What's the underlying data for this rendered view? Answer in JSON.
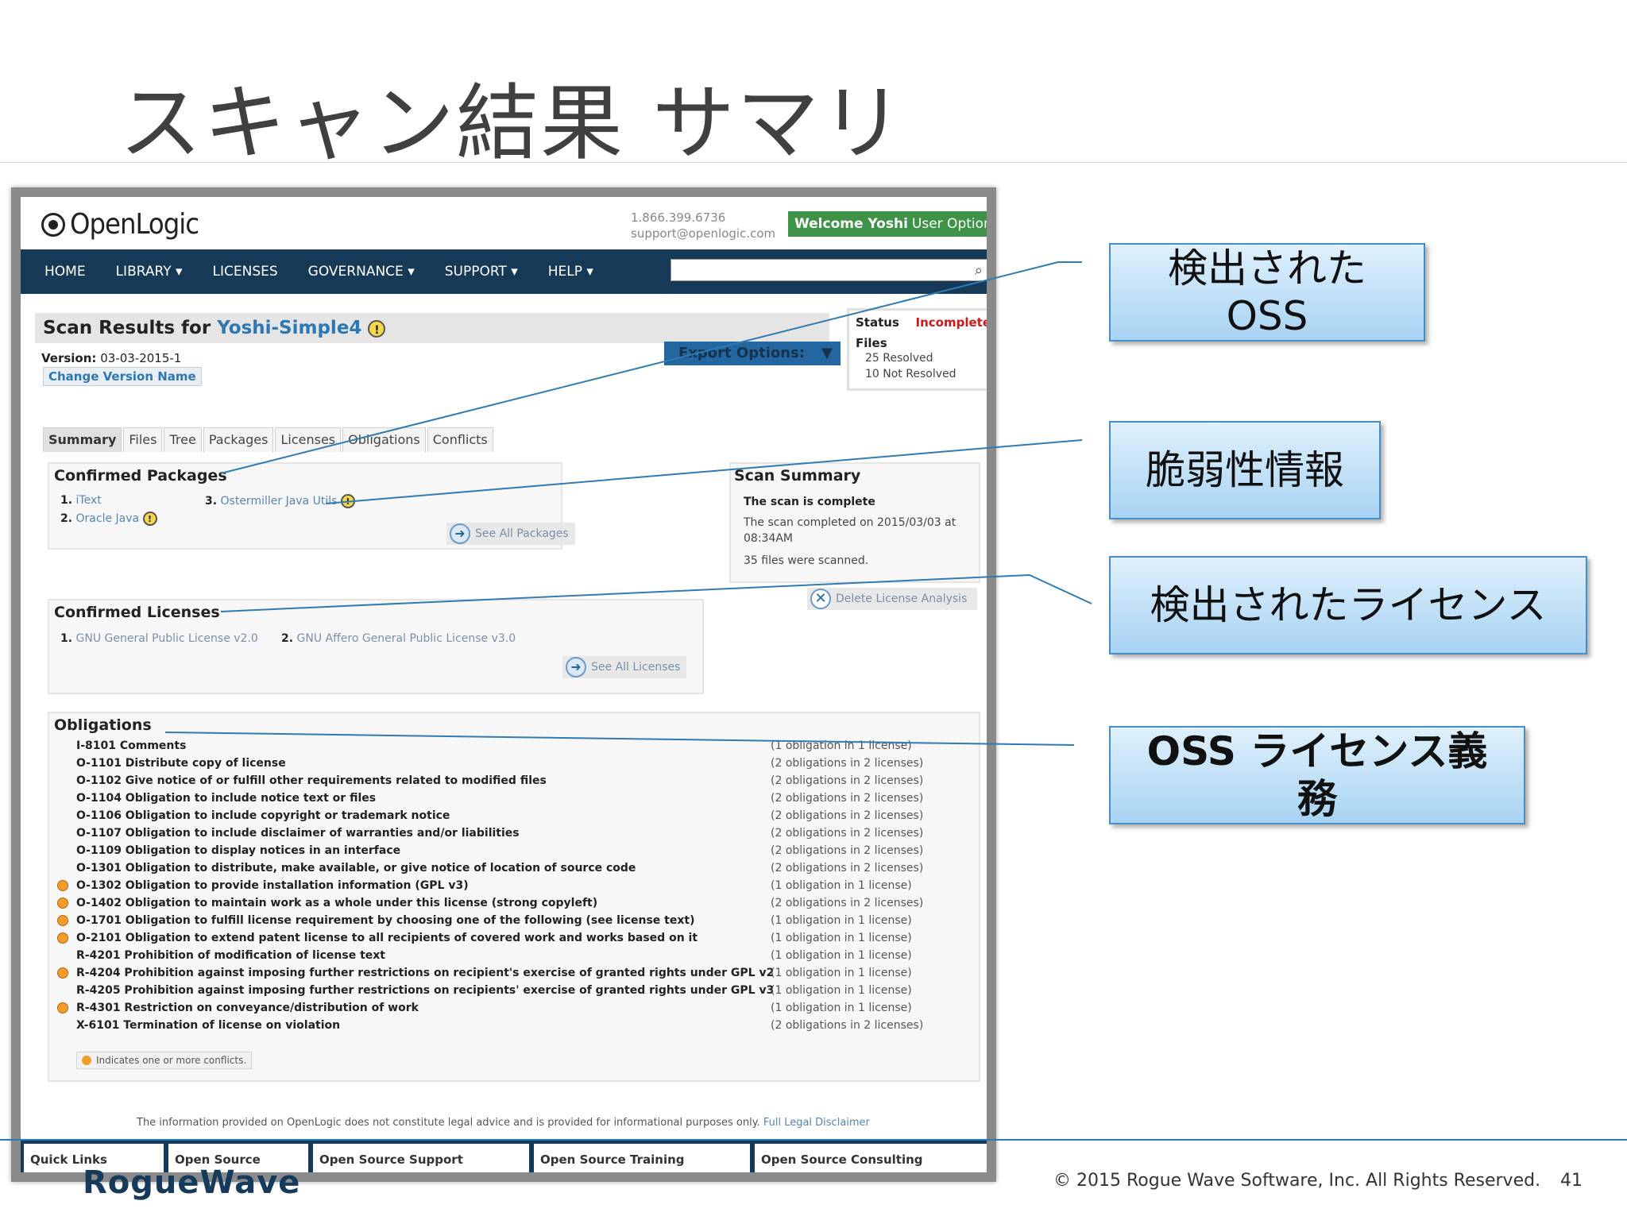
{
  "slide": {
    "title": "スキャン結果 サマリ",
    "copyright": "© 2015 Rogue Wave Software, Inc. All Rights Reserved.",
    "page_number": "41",
    "footer_logo": "RogueWave"
  },
  "app": {
    "logo": "OpenLogic",
    "phone": "1.866.399.6736",
    "email": "support@openlogic.com",
    "welcome_name": "Welcome Yoshi",
    "user_options": "User Options",
    "accent_color": "#3e9348",
    "nav_color": "#173958"
  },
  "nav": {
    "items": [
      "HOME",
      "LIBRARY ▾",
      "LICENSES",
      "GOVERNANCE ▾",
      "SUPPORT ▾",
      "HELP ▾"
    ],
    "search_placeholder": "",
    "search_icon": "search-icon"
  },
  "scan": {
    "title_prefix": "Scan Results for",
    "project": "Yoshi-Simple4",
    "warn_glyph": "!",
    "version_label": "Version:",
    "version_value": "03-03-2015-1",
    "change_version": "Change Version Name",
    "export": "Export Options:",
    "export_arrow": "▼",
    "status_label": "Status",
    "status_value": "Incomplete",
    "files_label": "Files",
    "resolved": "25 Resolved",
    "not_resolved": "10 Not Resolved"
  },
  "tabs": [
    "Summary",
    "Files",
    "Tree",
    "Packages",
    "Licenses",
    "Obligations",
    "Conflicts"
  ],
  "confirmed_packages": {
    "heading": "Confirmed Packages",
    "items": [
      {
        "num": "1.",
        "name": "iText"
      },
      {
        "num": "2.",
        "name": "Oracle Java"
      },
      {
        "num": "3.",
        "name": "Ostermiller Java Utils"
      }
    ],
    "see_all": "See All Packages"
  },
  "scan_summary": {
    "heading": "Scan Summary",
    "complete": "The scan is complete",
    "completed_line1": "The scan completed on 2015/03/03 at",
    "completed_line2": "08:34AM",
    "files_scanned": "35 files were scanned.",
    "delete": "Delete License Analysis"
  },
  "confirmed_licenses": {
    "heading": "Confirmed Licenses",
    "items": [
      {
        "num": "1.",
        "name": "GNU General Public License v2.0"
      },
      {
        "num": "2.",
        "name": "GNU Affero General Public License v3.0"
      }
    ],
    "see_all": "See All Licenses"
  },
  "obligations": {
    "heading": "Obligations",
    "rows": [
      {
        "name": "I-8101 Comments",
        "count": "(1 obligation in 1 license)",
        "conflict": false
      },
      {
        "name": "O-1101 Distribute copy of license",
        "count": "(2 obligations in 2 licenses)",
        "conflict": false
      },
      {
        "name": "O-1102 Give notice of or fulfill other requirements related to modified files",
        "count": "(2 obligations in 2 licenses)",
        "conflict": false
      },
      {
        "name": "O-1104 Obligation to include notice text or files",
        "count": "(2 obligations in 2 licenses)",
        "conflict": false
      },
      {
        "name": "O-1106 Obligation to include copyright or trademark notice",
        "count": "(2 obligations in 2 licenses)",
        "conflict": false
      },
      {
        "name": "O-1107 Obligation to include disclaimer of warranties and/or liabilities",
        "count": "(2 obligations in 2 licenses)",
        "conflict": false
      },
      {
        "name": "O-1109 Obligation to display notices in an interface",
        "count": "(2 obligations in 2 licenses)",
        "conflict": false
      },
      {
        "name": "O-1301 Obligation to distribute, make available, or give notice of location of source code",
        "count": "(2 obligations in 2 licenses)",
        "conflict": false
      },
      {
        "name": "O-1302 Obligation to provide installation information (GPL v3)",
        "count": "(1 obligation in 1 license)",
        "conflict": true
      },
      {
        "name": "O-1402 Obligation to maintain work as a whole under this license (strong copyleft)",
        "count": "(2 obligations in 2 licenses)",
        "conflict": true
      },
      {
        "name": "O-1701 Obligation to fulfill license requirement by choosing one of the following (see license text)",
        "count": "(1 obligation in 1 license)",
        "conflict": true
      },
      {
        "name": "O-2101 Obligation to extend patent license to all recipients of covered work and works based on it",
        "count": "(1 obligation in 1 license)",
        "conflict": true
      },
      {
        "name": "R-4201 Prohibition of modification of license text",
        "count": "(1 obligation in 1 license)",
        "conflict": false
      },
      {
        "name": "R-4204 Prohibition against imposing further restrictions on recipient's exercise of granted rights under GPL v2",
        "count": "(1 obligation in 1 license)",
        "conflict": true
      },
      {
        "name": "R-4205 Prohibition against imposing further restrictions on recipients' exercise of granted rights under GPL v3",
        "count": "(1 obligation in 1 license)",
        "conflict": false
      },
      {
        "name": "R-4301 Restriction on conveyance/distribution of work",
        "count": "(1 obligation in 1 license)",
        "conflict": true
      },
      {
        "name": "X-6101 Termination of license on violation",
        "count": "(2 obligations in 2 licenses)",
        "conflict": false
      }
    ],
    "legend": "Indicates one or more conflicts."
  },
  "footer": {
    "disclaimer": "The information provided on OpenLogic does not constitute legal advice and is provided for informational purposes only.",
    "disclaimer_link": "Full Legal Disclaimer",
    "tabs": [
      "Quick Links",
      "Open Source",
      "Open Source Support",
      "Open Source Training",
      "Open Source Consulting"
    ]
  },
  "callouts": {
    "detected_oss_line1": "検出された",
    "detected_oss_line2": "OSS",
    "vulnerability": "脆弱性情報",
    "detected_licenses": "検出されたライセンス",
    "obligations_line1": "OSS ライセンス義",
    "obligations_line2": "務"
  }
}
